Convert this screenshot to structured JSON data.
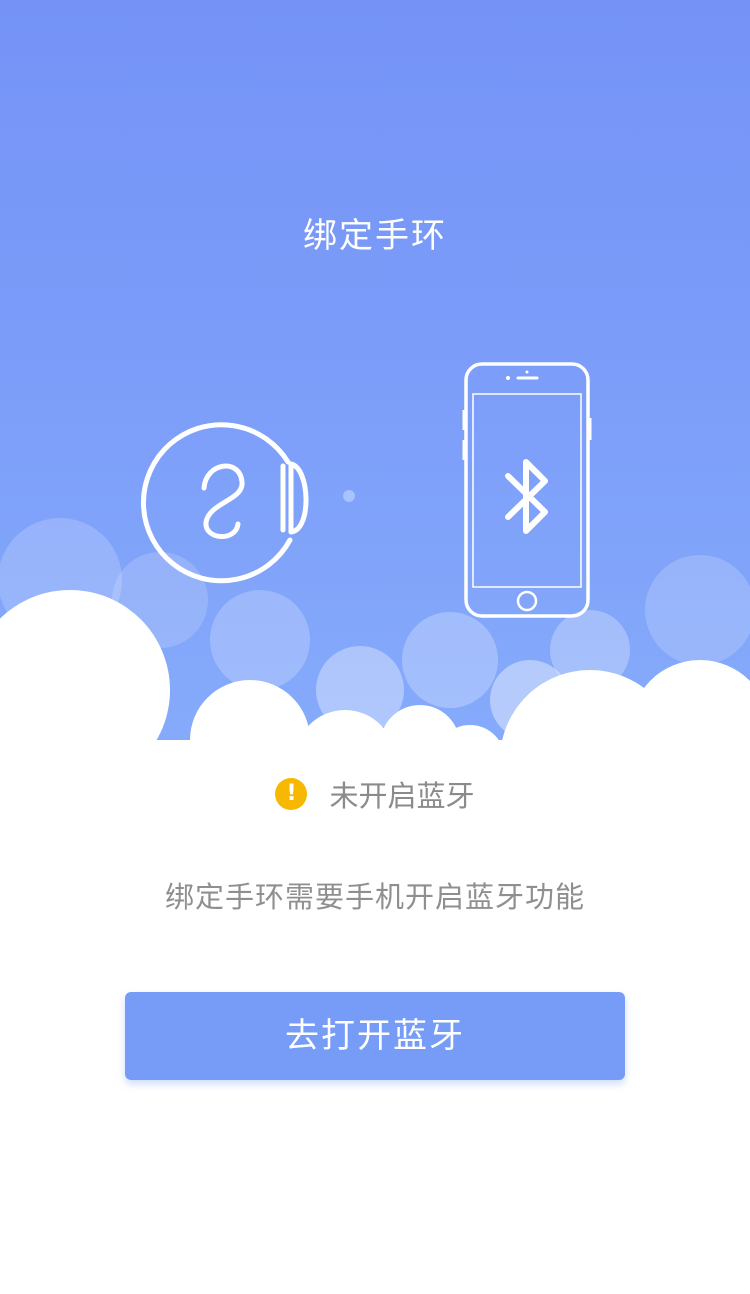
{
  "header": {
    "title": "绑定手环"
  },
  "illustration": {
    "band_icon": "band-icon",
    "phone_icon": "phone-icon",
    "bluetooth_icon": "bluetooth-icon"
  },
  "status": {
    "icon": "warning-icon",
    "text": "未开启蓝牙",
    "color": "#f6b800"
  },
  "description": "绑定手环需要手机开启蓝牙功能",
  "action": {
    "label": "去打开蓝牙"
  },
  "colors": {
    "accent": "#769cf7",
    "sky_top": "#7593f7",
    "warning": "#f6b800"
  }
}
